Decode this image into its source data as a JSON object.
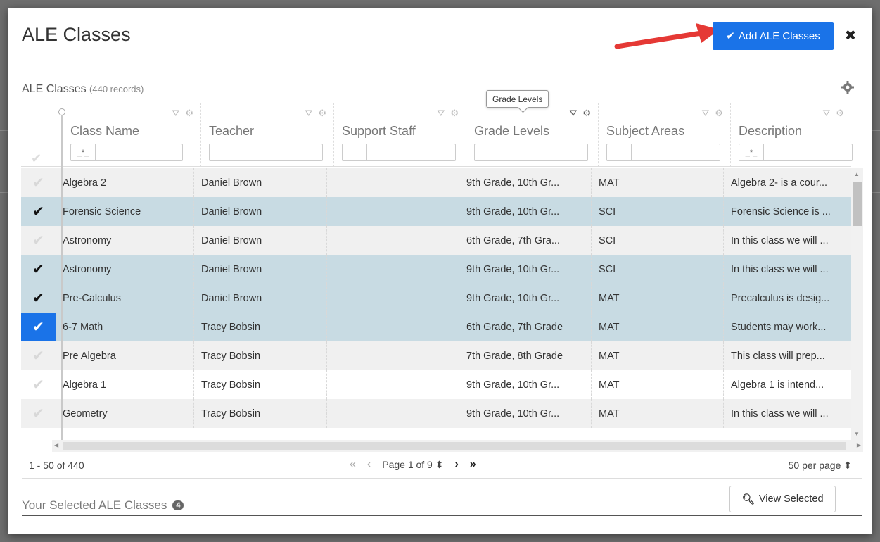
{
  "modal": {
    "title": "ALE Classes",
    "add_button_label": "Add ALE Classes",
    "close_icon": "✖"
  },
  "section": {
    "title": "ALE Classes",
    "records": "(440 records)"
  },
  "tooltip": "Grade Levels",
  "columns": [
    {
      "label": "Class Name",
      "filter": "_*_"
    },
    {
      "label": "Teacher",
      "filter": ""
    },
    {
      "label": "Support Staff",
      "filter": ""
    },
    {
      "label": "Grade Levels",
      "filter": ""
    },
    {
      "label": "Subject Areas",
      "filter": ""
    },
    {
      "label": "Description",
      "filter": "_*_"
    }
  ],
  "rows": [
    {
      "class_name": "Algebra 2",
      "teacher": "Daniel Brown",
      "support_staff": "",
      "grade_levels": "9th Grade, 10th Gr...",
      "subject": "MAT",
      "description": "Algebra 2- is a cour...",
      "checked": false
    },
    {
      "class_name": "Forensic Science",
      "teacher": "Daniel Brown",
      "support_staff": "",
      "grade_levels": "9th Grade, 10th Gr...",
      "subject": "SCI",
      "description": "Forensic Science is ...",
      "checked": true
    },
    {
      "class_name": "Astronomy",
      "teacher": "Daniel Brown",
      "support_staff": "",
      "grade_levels": "6th Grade, 7th Gra...",
      "subject": "SCI",
      "description": "In this class we will ...",
      "checked": false
    },
    {
      "class_name": "Astronomy",
      "teacher": "Daniel Brown",
      "support_staff": "",
      "grade_levels": "9th Grade, 10th Gr...",
      "subject": "SCI",
      "description": "In this class we will ...",
      "checked": true
    },
    {
      "class_name": "Pre-Calculus",
      "teacher": "Daniel Brown",
      "support_staff": "",
      "grade_levels": "9th Grade, 10th Gr...",
      "subject": "MAT",
      "description": "Precalculus is desig...",
      "checked": true
    },
    {
      "class_name": "6-7 Math",
      "teacher": "Tracy Bobsin",
      "support_staff": "",
      "grade_levels": "6th Grade, 7th Grade",
      "subject": "MAT",
      "description": "Students may work...",
      "checked": true,
      "active": true
    },
    {
      "class_name": "Pre Algebra",
      "teacher": "Tracy Bobsin",
      "support_staff": "",
      "grade_levels": "7th Grade, 8th Grade",
      "subject": "MAT",
      "description": "This class will prep...",
      "checked": false
    },
    {
      "class_name": "Algebra 1",
      "teacher": "Tracy Bobsin",
      "support_staff": "",
      "grade_levels": "9th Grade, 10th Gr...",
      "subject": "MAT",
      "description": "Algebra 1 is intend...",
      "checked": false
    },
    {
      "class_name": "Geometry",
      "teacher": "Tracy Bobsin",
      "support_staff": "",
      "grade_levels": "9th Grade, 10th Gr...",
      "subject": "MAT",
      "description": "In this class we will ...",
      "checked": false
    }
  ],
  "pager": {
    "range": "1 - 50 of 440",
    "first": "«",
    "prev": "‹",
    "page_label": "Page 1 of 9 ⬍",
    "next": "›",
    "last": "»",
    "per_page": "50 per page ⬍"
  },
  "selected": {
    "title": "Your Selected ALE Classes",
    "count": "4",
    "view_button_label": "View Selected"
  },
  "colors": {
    "accent": "#1a73e8",
    "selected_row": "#c8dbe3",
    "alt_row": "#f0f0f0"
  }
}
